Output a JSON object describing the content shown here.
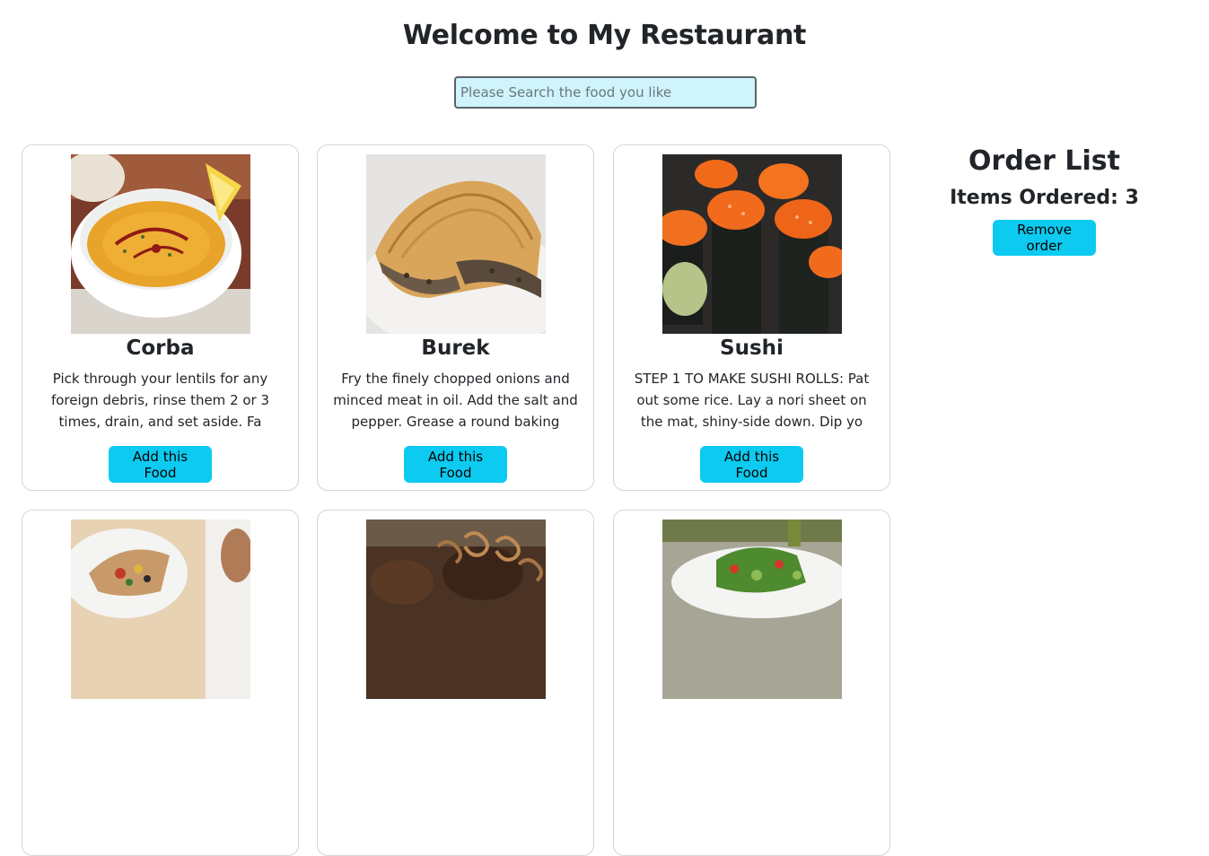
{
  "header": {
    "title": "Welcome to My Restaurant"
  },
  "search": {
    "placeholder": "Please Search the food you like",
    "value": ""
  },
  "foods": [
    {
      "name": "Corba",
      "description": "Pick through your lentils for any foreign debris, rinse them 2 or 3 times, drain, and set aside. Fa",
      "button_label": "Add this Food",
      "image": "lentil-soup-image"
    },
    {
      "name": "Burek",
      "description": "Fry the finely chopped onions and minced meat in oil. Add the salt and pepper. Grease a round baking",
      "button_label": "Add this Food",
      "image": "burek-pastry-image"
    },
    {
      "name": "Sushi",
      "description": "STEP 1 TO MAKE SUSHI ROLLS: Pat out some rice. Lay a nori sheet on the mat, shiny-side down. Dip yo",
      "button_label": "Add this Food",
      "image": "sushi-rolls-image"
    }
  ],
  "partial_row_images": [
    "wrap-image",
    "grilled-meat-onion-image",
    "salad-image"
  ],
  "order": {
    "title": "Order List",
    "items_label": "Items Ordered: 3",
    "remove_label": "Remove order"
  },
  "colors": {
    "accent": "#0dcaf0",
    "search_bg": "#cff4fc"
  }
}
